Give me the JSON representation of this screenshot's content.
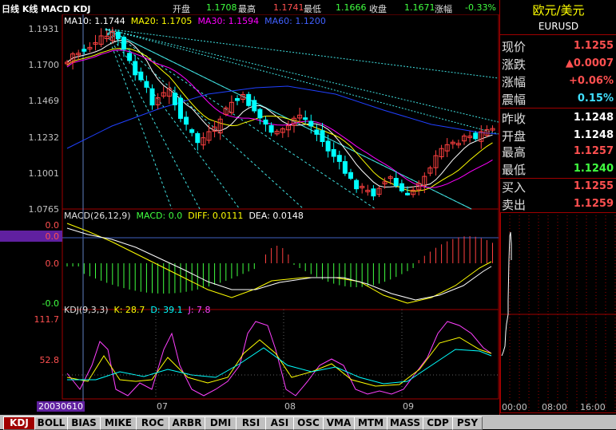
{
  "header": {
    "title": "日线 K线 MACD KDJ",
    "open_label": "开盘",
    "open_value": "1.1708",
    "high_label": "最高",
    "high_value": "1.1741",
    "low_label": "最低",
    "low_value": "1.1666",
    "close_label": "收盘",
    "close_value": "1.1671",
    "change_label": "涨幅",
    "change_value": "-0.33%"
  },
  "ma_legend": {
    "ma10": "MA10: 1.1744",
    "ma20": "MA20: 1.1705",
    "ma30": "MA30: 1.1594",
    "ma60": "MA60: 1.1200"
  },
  "price_axis": [
    "1.1931",
    "1.1700",
    "1.1469",
    "1.1232",
    "1.1001",
    "1.0765"
  ],
  "macd_legend": {
    "name": "MACD(26,12,9)",
    "macd": "MACD: 0.0",
    "diff": "DIFF: 0.0111",
    "dea": "DEA: 0.0148"
  },
  "macd_axis": [
    "0.0",
    "0.0",
    "0.0",
    "-0.0"
  ],
  "kdj_legend": {
    "name": "KDJ(9,3,3)",
    "k": "K: 28.7",
    "d": "D: 39.1",
    "j": "J: 7.8"
  },
  "kdj_axis": [
    "111.7",
    "52.8"
  ],
  "date_axis": {
    "start": "20030610",
    "m07": "07",
    "m08": "08",
    "m09": "09"
  },
  "right_panel": {
    "pair_name": "欧元/美元",
    "pair_code": "EURUSD",
    "rows": [
      {
        "label": "现价",
        "value": "1.1255",
        "color": "#ff5050"
      },
      {
        "label": "涨跌",
        "value": "▲0.0007",
        "color": "#ff5050"
      },
      {
        "label": "涨幅",
        "value": "+0.06%",
        "color": "#ff5050"
      },
      {
        "label": "震幅",
        "value": "0.15%",
        "color": "#40e0ff"
      },
      {
        "label": "昨收",
        "value": "1.1248",
        "color": "#ffffff"
      },
      {
        "label": "开盘",
        "value": "1.1248",
        "color": "#ffffff"
      },
      {
        "label": "最高",
        "value": "1.1257",
        "color": "#ff5050"
      },
      {
        "label": "最低",
        "value": "1.1240",
        "color": "#40ff40"
      },
      {
        "label": "买入",
        "value": "1.1255",
        "color": "#ff5050"
      },
      {
        "label": "卖出",
        "value": "1.1259",
        "color": "#ff5050"
      }
    ],
    "time_axis": [
      "00:00",
      "08:00",
      "16:00"
    ]
  },
  "tabs": [
    "KDJ",
    "BOLL",
    "BIAS",
    "MIKE",
    "ROC",
    "ARBR",
    "DMI",
    "RSI",
    "ASI",
    "OSC",
    "VMA",
    "MTM",
    "MASS",
    "CDP",
    "PSY"
  ],
  "colors": {
    "ma10": "#ffffff",
    "ma20": "#ffff00",
    "ma30": "#ff00ff",
    "ma60": "#2040ff",
    "up": "#ff4040",
    "down": "#00ffff",
    "frame": "#a00000"
  }
}
